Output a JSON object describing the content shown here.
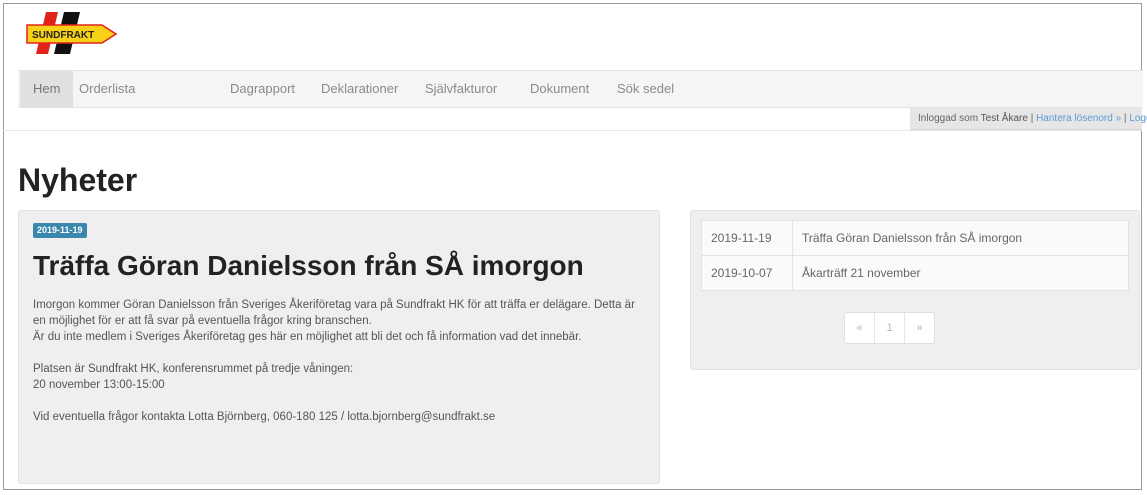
{
  "brand": {
    "logo_text": "SUNDFRAKT",
    "colors": {
      "yellow": "#f7d117",
      "red": "#e2231a",
      "black": "#111111"
    }
  },
  "nav": {
    "items": [
      {
        "label": "Hem",
        "active": true
      },
      {
        "label": "Orderlista",
        "active": false
      },
      {
        "label": "Dagrapport",
        "active": false
      },
      {
        "label": "Deklarationer",
        "active": false
      },
      {
        "label": "Självfakturor",
        "active": false
      },
      {
        "label": "Dokument",
        "active": false
      },
      {
        "label": "Sök sedel",
        "active": false
      }
    ]
  },
  "userbar": {
    "logged_in_prefix": "Inloggad som",
    "user_name": "Test Åkare",
    "separator": "|",
    "manage_password": "Hantera lösenord »",
    "logout": "Logga ut »"
  },
  "page": {
    "title": "Nyheter"
  },
  "article": {
    "date": "2019-11-19",
    "title": "Träffa Göran Danielsson från SÅ imorgon",
    "paragraphs": [
      "Imorgon kommer Göran Danielsson från Sveriges Åkeriföretag vara på Sundfrakt HK för att träffa er delägare. Detta är en möjlighet för er att få svar på eventuella frågor kring branschen.",
      "Är du inte medlem i Sveriges Åkeriföretag ges här en möjlighet att bli det och få information vad det innebär.",
      "Platsen är Sundfrakt HK, konferensrummet på tredje våningen:",
      "20 november 13:00-15:00",
      "Vid eventuella frågor kontakta Lotta Björnberg, 060-180 125 / lotta.bjornberg@sundfrakt.se"
    ]
  },
  "news_list": {
    "rows": [
      {
        "date": "2019-11-19",
        "title": "Träffa Göran Danielsson från SÅ imorgon"
      },
      {
        "date": "2019-10-07",
        "title": "Åkarträff 21 november"
      }
    ],
    "pager": {
      "prev": "«",
      "page": "1",
      "next": "»"
    }
  }
}
